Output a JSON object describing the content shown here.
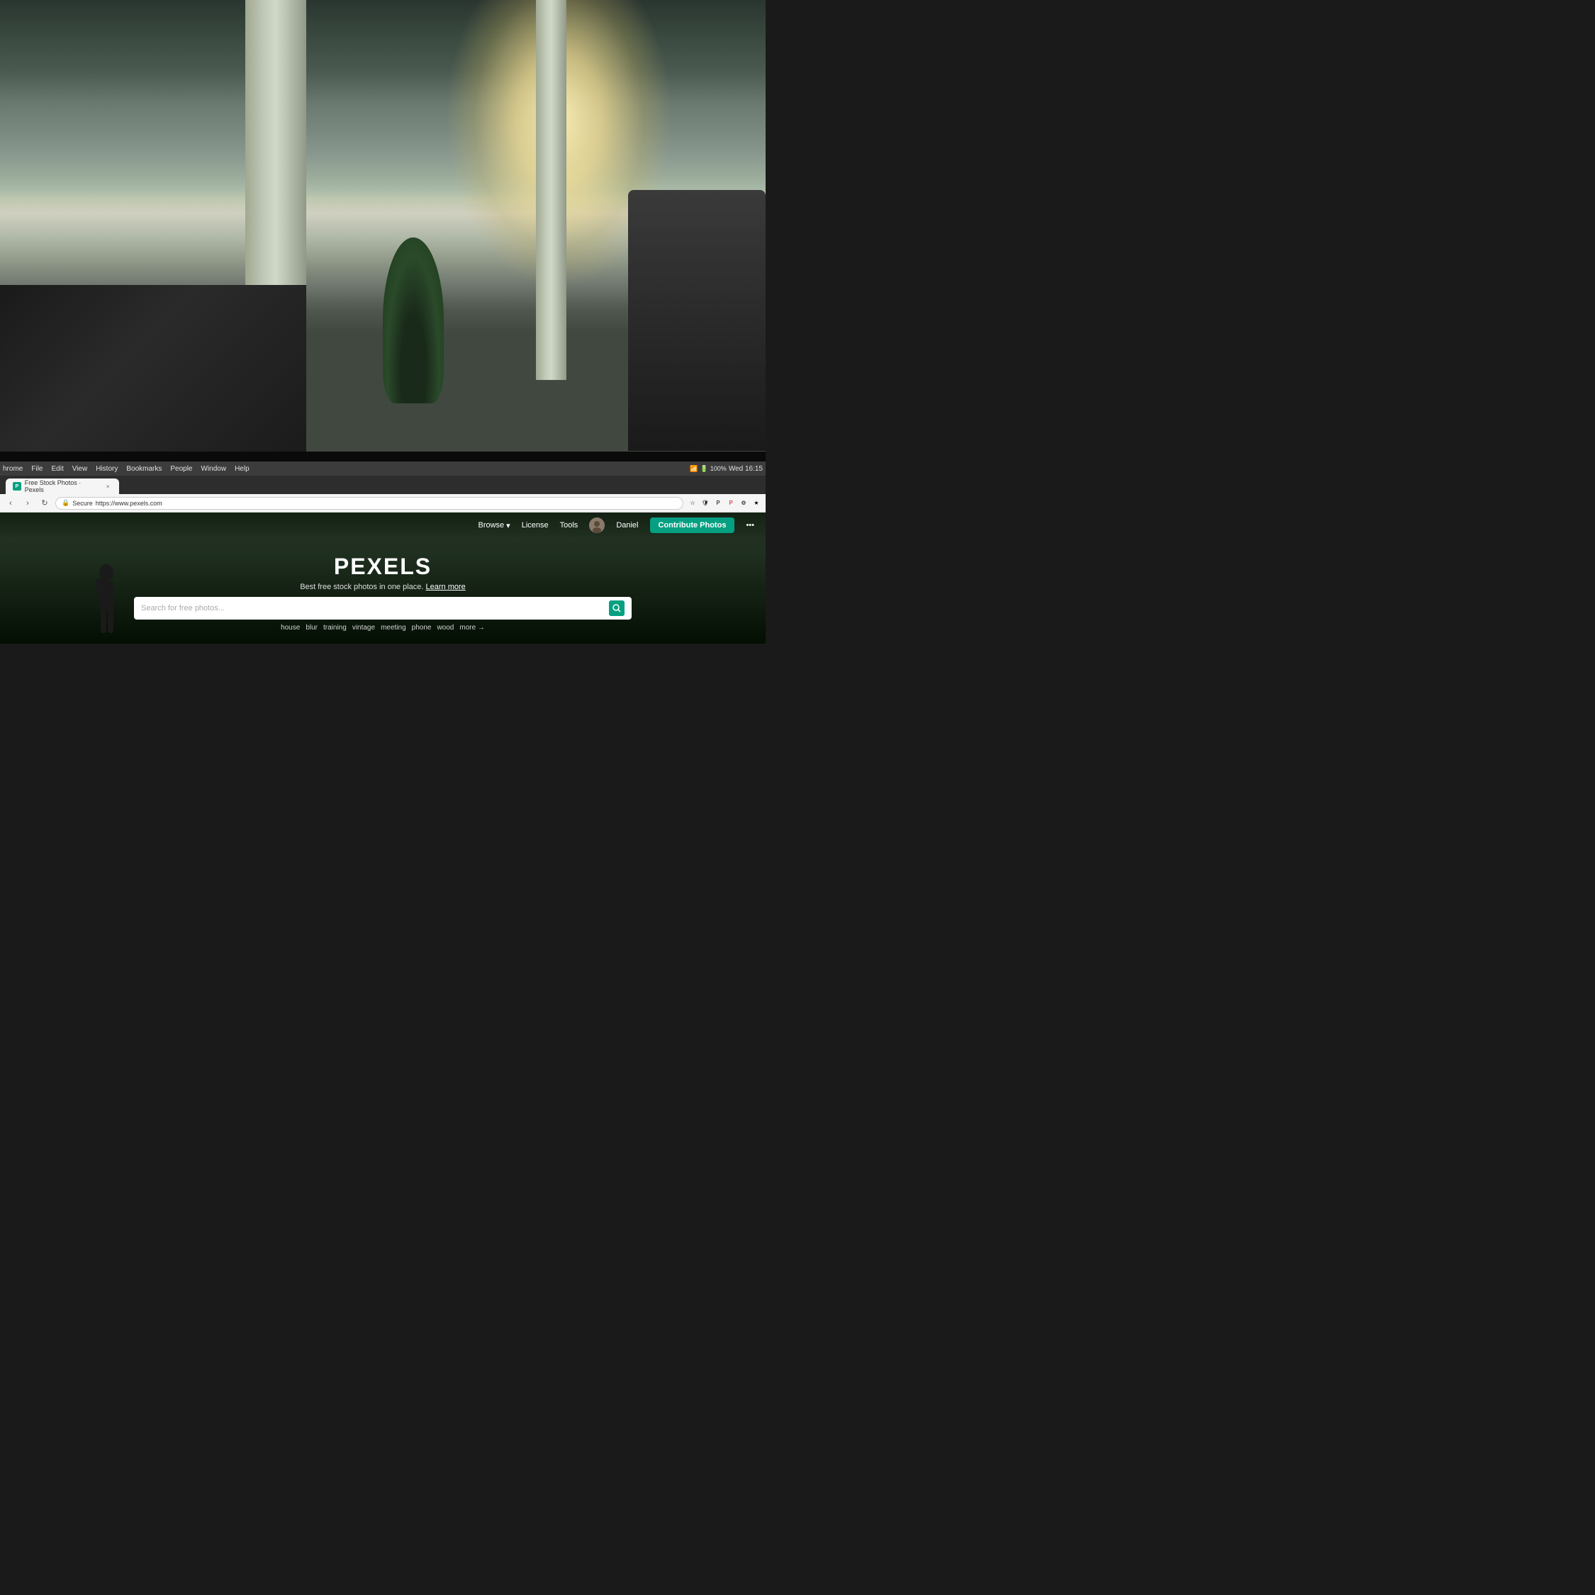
{
  "photo": {
    "description": "Office space background photo with warm light",
    "alt": "Office with pillars and natural light"
  },
  "browser": {
    "menu_items": [
      "hrome",
      "File",
      "Edit",
      "View",
      "History",
      "Bookmarks",
      "People",
      "Window",
      "Help"
    ],
    "time": "Wed 16:15",
    "battery": "100%",
    "tab_title": "Free Stock Photos · Pexels",
    "tab_close": "×",
    "address": "https://www.pexels.com",
    "secure_label": "Secure",
    "nav_back": "‹",
    "nav_forward": "›",
    "nav_refresh": "↻"
  },
  "pexels": {
    "nav": {
      "browse_label": "Browse",
      "browse_arrow": "▾",
      "license_label": "License",
      "tools_label": "Tools",
      "user_name": "Daniel",
      "contribute_label": "Contribute Photos",
      "more_icon": "•••"
    },
    "hero": {
      "title": "PEXELS",
      "subtitle": "Best free stock photos in one place.",
      "learn_more": "Learn more",
      "search_placeholder": "Search for free photos...",
      "search_icon": "🔍"
    },
    "suggestions": {
      "tags": [
        "house",
        "blur",
        "training",
        "vintage",
        "meeting",
        "phone",
        "wood"
      ],
      "more_label": "more →"
    }
  }
}
